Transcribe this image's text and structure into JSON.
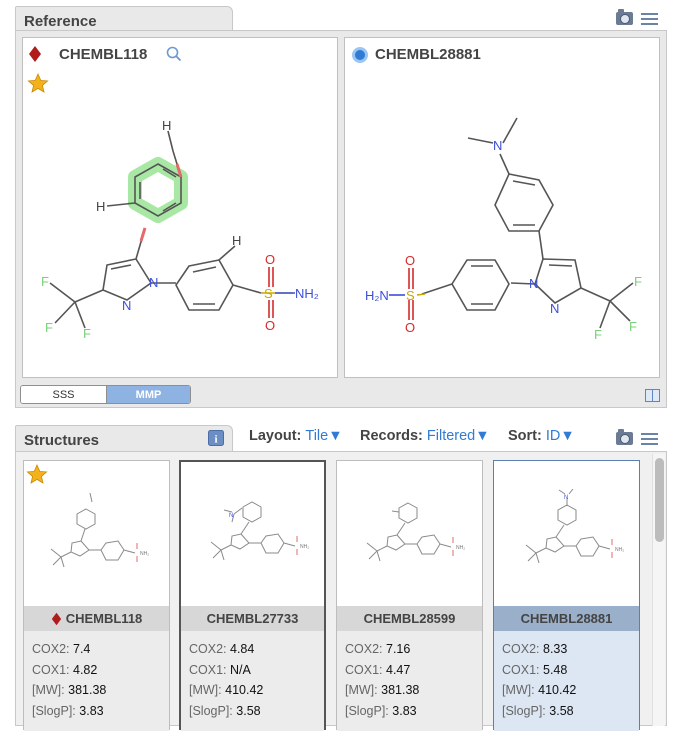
{
  "reference": {
    "title": "Reference",
    "left_molecule": {
      "id": "CHEMBL118"
    },
    "right_molecule": {
      "id": "CHEMBL28881"
    },
    "modes": [
      "SSS",
      "MMP"
    ],
    "active_mode": "MMP"
  },
  "structures": {
    "title": "Structures",
    "layout_label": "Layout:",
    "layout_value": "Tile▼",
    "records_label": "Records:",
    "records_value": "Filtered▼",
    "sort_label": "Sort:",
    "sort_value": "ID▼",
    "tiles": [
      {
        "id": "CHEMBL118",
        "cox2": "7.4",
        "cox1": "4.82",
        "mw": "381.38",
        "slogp": "3.83"
      },
      {
        "id": "CHEMBL27733",
        "cox2": "4.84",
        "cox1": "N/A",
        "mw": "410.42",
        "slogp": "3.58"
      },
      {
        "id": "CHEMBL28599",
        "cox2": "7.16",
        "cox1": "4.47",
        "mw": "381.38",
        "slogp": "3.83"
      },
      {
        "id": "CHEMBL28881",
        "cox2": "8.33",
        "cox1": "5.48",
        "mw": "410.42",
        "slogp": "3.58"
      }
    ],
    "prop_labels": {
      "cox2": "COX2:",
      "cox1": "COX1:",
      "mw": "[MW]:",
      "slogp": "[SlogP]:"
    }
  },
  "atoms": {
    "H": "H",
    "F": "F",
    "N": "N",
    "O": "O",
    "S": "S",
    "NH2": "NH₂",
    "H2N": "H₂N"
  },
  "colors": {
    "accent": "#2f7bd6",
    "highlight": "#9fe59c",
    "diamond": "#b01c1c",
    "star": "#f3b21b"
  }
}
